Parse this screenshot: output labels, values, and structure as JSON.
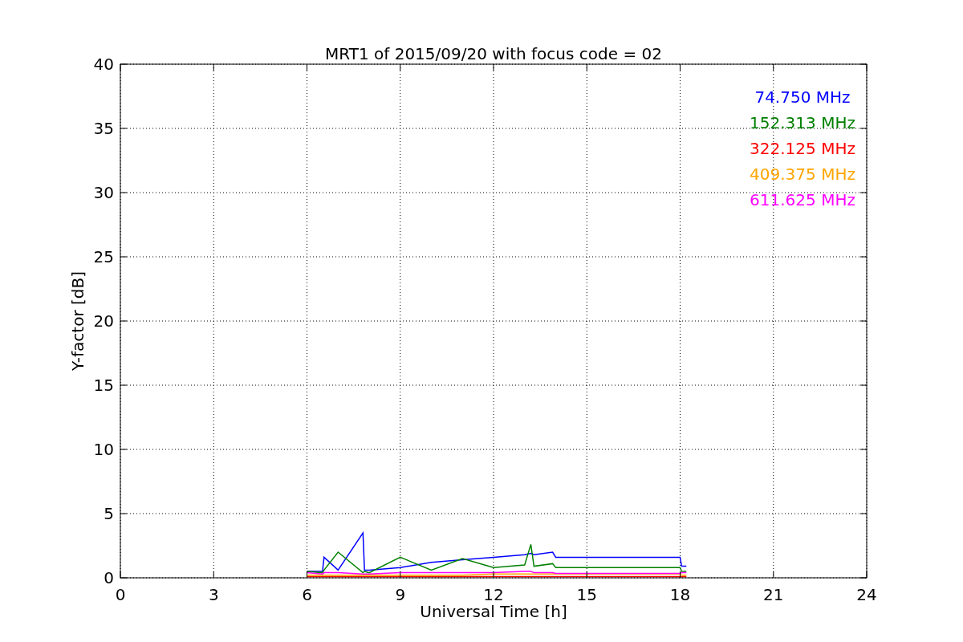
{
  "chart_data": {
    "type": "line",
    "title": "MRT1 of 2015/09/20 with focus code = 02",
    "xlabel": "Universal Time [h]",
    "ylabel": "Y-factor [dB]",
    "x": [
      6,
      6.5,
      6.55,
      7,
      7.8,
      7.85,
      8,
      9,
      10,
      11,
      12,
      13,
      13.2,
      13.3,
      13.9,
      14,
      18,
      18.05,
      18.2
    ],
    "series": [
      {
        "name": "74.750 MHz",
        "color": "#0000ff",
        "values": [
          0.5,
          0.5,
          1.6,
          0.6,
          3.5,
          0.6,
          0.6,
          0.8,
          1.2,
          1.4,
          1.6,
          1.8,
          1.9,
          1.8,
          2.0,
          1.6,
          1.6,
          0.9,
          0.9
        ]
      },
      {
        "name": "152.313 MHz",
        "color": "#008000",
        "values": [
          0.5,
          0.4,
          0.6,
          2.0,
          0.4,
          0.5,
          0.4,
          1.6,
          0.6,
          1.5,
          0.8,
          1.0,
          2.6,
          0.9,
          1.1,
          0.8,
          0.8,
          0.5,
          0.5
        ]
      },
      {
        "name": "322.125 MHz",
        "color": "#ff0000",
        "values": [
          0.1,
          0.1,
          0.1,
          0.1,
          0.1,
          0.1,
          0.1,
          0.1,
          0.1,
          0.1,
          0.1,
          0.1,
          0.1,
          0.1,
          0.1,
          0.1,
          0.1,
          0.1,
          0.1
        ]
      },
      {
        "name": "409.375 MHz",
        "color": "#ffa500",
        "values": [
          0.2,
          0.2,
          0.2,
          0.2,
          0.2,
          0.2,
          0.2,
          0.2,
          0.2,
          0.2,
          0.3,
          0.3,
          0.3,
          0.3,
          0.3,
          0.3,
          0.3,
          0.2,
          0.2
        ]
      },
      {
        "name": "611.625 MHz",
        "color": "#ff00ff",
        "values": [
          0.4,
          0.3,
          0.4,
          0.4,
          0.3,
          0.3,
          0.3,
          0.4,
          0.4,
          0.4,
          0.4,
          0.5,
          0.5,
          0.4,
          0.4,
          0.35,
          0.35,
          0.4,
          0.4
        ]
      }
    ],
    "grid": true,
    "xlim": [
      0,
      24
    ],
    "ylim": [
      0,
      40
    ],
    "xticks": [
      0,
      3,
      6,
      9,
      12,
      15,
      18,
      21,
      24
    ],
    "yticks": [
      0,
      5,
      10,
      15,
      20,
      25,
      30,
      35,
      40
    ]
  }
}
